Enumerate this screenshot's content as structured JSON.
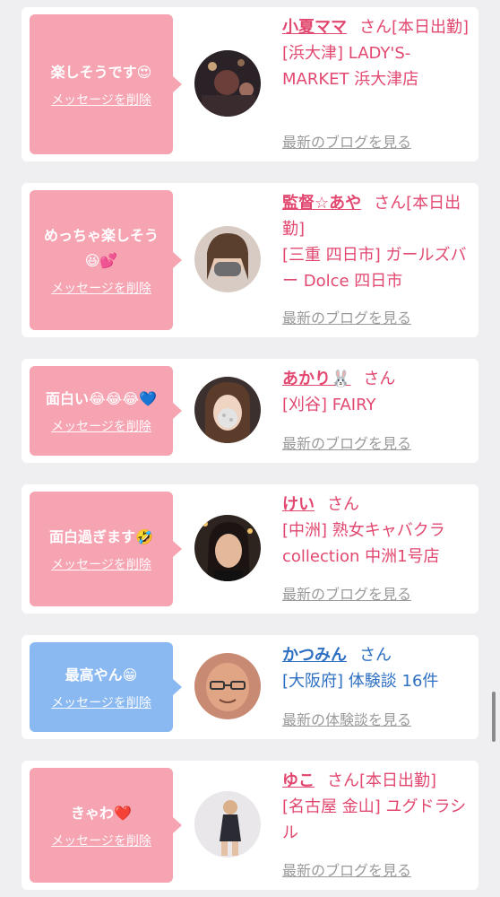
{
  "delete_label": "メッセージを削除",
  "colors": {
    "pink_bubble": "#f6a3b2",
    "blue_bubble": "#8ab9f2",
    "pink_text": "#e2486f",
    "blue_text": "#2d6fc2"
  },
  "items": [
    {
      "message": "楽しそうです😍",
      "name": "小夏ママ",
      "suffix": "さん[本日出勤]",
      "shop": "[浜大津] LADY'S-MARKET 浜大津店",
      "link": "最新のブログを見る",
      "theme": "pink"
    },
    {
      "message": "めっちゃ楽しそう😆💕",
      "name": "監督☆あや",
      "suffix": "さん[本日出勤]",
      "shop": "[三重 四日市] ガールズバー Dolce 四日市",
      "link": "最新のブログを見る",
      "theme": "pink"
    },
    {
      "message": "面白い😂😂😂💙",
      "name": "あかり🐰",
      "suffix": "さん",
      "shop": "[刈谷] FAIRY",
      "link": "最新のブログを見る",
      "theme": "pink"
    },
    {
      "message": "面白過ぎます🤣",
      "name": "けい",
      "suffix": "さん",
      "shop": "[中洲] 熟女キャバクラ collection 中洲1号店",
      "link": "最新のブログを見る",
      "theme": "pink"
    },
    {
      "message": "最高やん😁",
      "name": "かつみん",
      "suffix": "さん",
      "shop": "[大阪府] 体験談 16件",
      "link": "最新の体験談を見る",
      "theme": "blue"
    },
    {
      "message": "きゃわ❤️",
      "name": "ゆこ",
      "suffix": "さん[本日出勤]",
      "shop": "[名古屋 金山] ユグドラシル",
      "link": "最新のブログを見る",
      "theme": "pink"
    }
  ]
}
